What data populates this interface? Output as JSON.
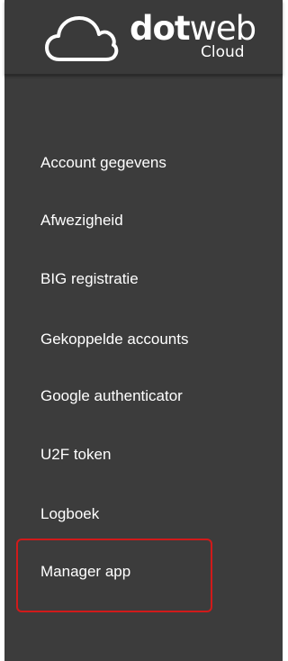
{
  "brand": {
    "name_bold": "dot",
    "name_light": "web",
    "subtitle": "Cloud",
    "icon": "cloud-icon"
  },
  "menu": {
    "items": [
      {
        "label": "Account gegevens"
      },
      {
        "label": "Afwezigheid"
      },
      {
        "label": "BIG registratie"
      },
      {
        "label": "Gekoppelde accounts"
      },
      {
        "label": "Google authenticator"
      },
      {
        "label": "U2F token"
      },
      {
        "label": "Logboek"
      },
      {
        "label": "Manager app"
      }
    ]
  },
  "colors": {
    "sidebar_bg": "#3c3c3c",
    "text": "#ffffff",
    "highlight_border": "#d11a1a"
  }
}
